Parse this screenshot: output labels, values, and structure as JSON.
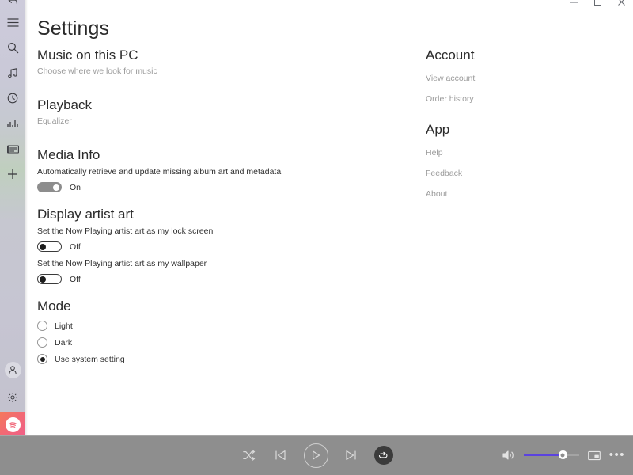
{
  "window": {
    "controls": [
      {
        "name": "minimize-button",
        "glyph": "minimize"
      },
      {
        "name": "maximize-button",
        "glyph": "maximize"
      },
      {
        "name": "close-button",
        "glyph": "close"
      }
    ]
  },
  "rail": {
    "top_items": [
      {
        "icon": "back-arrow-icon",
        "label": "Back"
      },
      {
        "icon": "hamburger-menu-icon",
        "label": "Menu"
      },
      {
        "icon": "search-icon",
        "label": "Search"
      },
      {
        "icon": "music-note-icon",
        "label": "My music"
      },
      {
        "icon": "clock-history-icon",
        "label": "Recent plays"
      },
      {
        "icon": "equalizer-bars-icon",
        "label": "Now playing"
      },
      {
        "icon": "playlist-icon",
        "label": "Playlists"
      },
      {
        "icon": "plus-icon",
        "label": "New playlist"
      }
    ],
    "bottom_items": [
      {
        "icon": "account-person-icon",
        "label": "Account"
      },
      {
        "icon": "gear-settings-icon",
        "label": "Settings"
      },
      {
        "icon": "spotify-brand-icon",
        "label": "Spotify"
      }
    ],
    "brand_color": "#f16a78"
  },
  "page": {
    "title": "Settings"
  },
  "left_column": {
    "music_on_pc": {
      "heading": "Music on this PC",
      "link": "Choose where we look for music"
    },
    "playback": {
      "heading": "Playback",
      "link": "Equalizer"
    },
    "media_info": {
      "heading": "Media Info",
      "description": "Automatically retrieve and update missing album art and metadata",
      "toggle_state": "On"
    },
    "display_artist_art": {
      "heading": "Display artist art",
      "lock_screen": {
        "description": "Set the Now Playing artist art as my lock screen",
        "toggle_state": "Off"
      },
      "wallpaper": {
        "description": "Set the Now Playing artist art as my wallpaper",
        "toggle_state": "Off"
      }
    },
    "mode": {
      "heading": "Mode",
      "options": [
        {
          "label": "Light",
          "selected": false
        },
        {
          "label": "Dark",
          "selected": false
        },
        {
          "label": "Use system setting",
          "selected": true
        }
      ]
    }
  },
  "right_column": {
    "account": {
      "heading": "Account",
      "links": [
        "View account",
        "Order history"
      ]
    },
    "app": {
      "heading": "App",
      "links": [
        "Help",
        "Feedback",
        "About"
      ]
    }
  },
  "player": {
    "shuffle_label": "Shuffle",
    "previous_label": "Previous",
    "play_label": "Play",
    "next_label": "Next",
    "repeat_label": "Repeat",
    "repeat_active": true,
    "volume_label": "Volume",
    "volume_percent": 63,
    "mini_view_label": "Mini view",
    "more_label": "More options",
    "more_glyph": "•••",
    "accent_color": "#5b43e0",
    "bar_color": "#8e8e8e"
  }
}
